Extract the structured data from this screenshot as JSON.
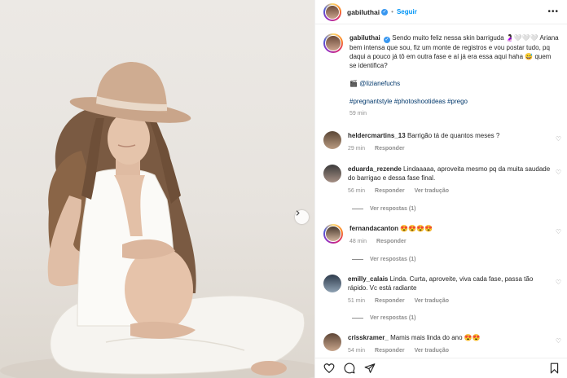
{
  "post": {
    "username": "gabiluthai",
    "follow_label": "Seguir",
    "caption": "Sendo muito feliz nessa skin barriguda 🤰🏻🤍🤍🤍 Ariana bem intensa que sou, fiz um monte de registros e vou postar tudo, pq daqui a pouco já tô em outra fase e aí já era essa aqui haha 😅 quem se identifica?",
    "credit_icon": "🎬",
    "credit": "@lizianefuchs",
    "hashtags": "#pregnantstyle #photoshootideas #prego",
    "time": "59 min"
  },
  "comments": [
    {
      "user": "heldercmartins_13",
      "text": "Barrigão tá de quantos meses ?",
      "time": "29 min",
      "reply": "Responder",
      "translate": ""
    },
    {
      "user": "eduarda_rezende",
      "text": "Lindaaaaa, aproveita mesmo pq da muita saudade do barrigao e dessa fase final.",
      "time": "56 min",
      "reply": "Responder",
      "translate": "Ver tradução",
      "replies": "Ver respostas (1)"
    },
    {
      "user": "fernandacanton",
      "text": "😍😍😍😍",
      "time": "48 min",
      "reply": "Responder",
      "translate": "",
      "replies": "Ver respostas (1)"
    },
    {
      "user": "emilly_calais",
      "text": "Linda. Curta, aproveite, viva cada fase, passa tão rápido. Vc está radiante",
      "time": "51 min",
      "reply": "Responder",
      "translate": "Ver tradução",
      "replies": "Ver respostas (1)"
    },
    {
      "user": "crisskramer_",
      "text": "Mamis mais linda do ano 😍😍",
      "time": "54 min",
      "reply": "Responder",
      "translate": "Ver tradução"
    }
  ],
  "icons": {
    "like": "heart-icon",
    "comment": "comment-icon",
    "share": "share-icon",
    "save": "bookmark-icon",
    "next": "chevron-right-icon",
    "more": "more-options-icon",
    "verified": "verified-badge-icon",
    "comment_like": "heart-outline-icon"
  },
  "colors": {
    "link": "#00376b",
    "follow": "#0095f6",
    "verified": "#3897f0",
    "muted": "#8e8e8e"
  }
}
